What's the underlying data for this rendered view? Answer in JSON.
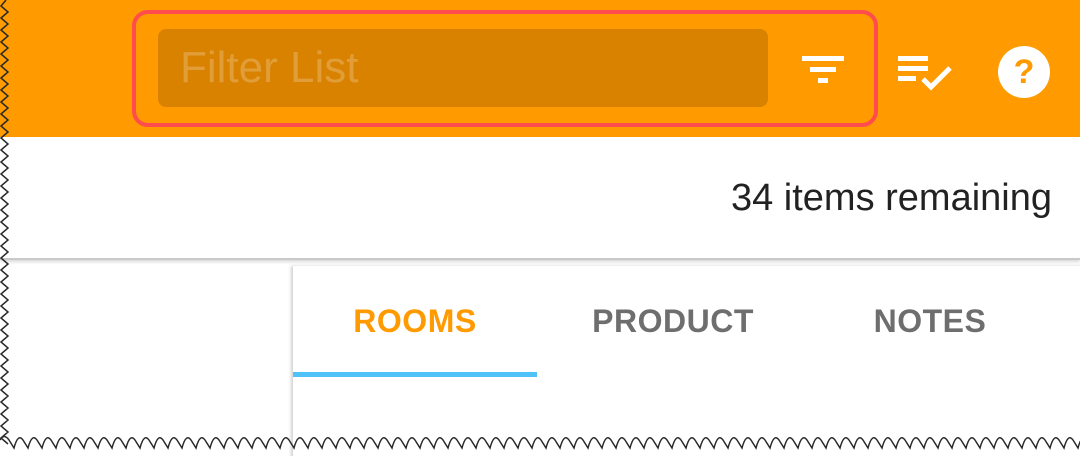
{
  "colors": {
    "accent": "#ff9a00",
    "field": "#d98200",
    "indicator": "#4fc3f7",
    "highlight": "#ff4d4d"
  },
  "header": {
    "filter_placeholder": "Filter List",
    "icons": [
      "filter-icon",
      "playlist-check-icon",
      "help-icon"
    ]
  },
  "status": {
    "remaining_text": "34 items remaining"
  },
  "tabs": [
    {
      "label": "ROOMS",
      "active": true
    },
    {
      "label": "PRODUCT",
      "active": false
    },
    {
      "label": "NOTES",
      "active": false
    }
  ]
}
